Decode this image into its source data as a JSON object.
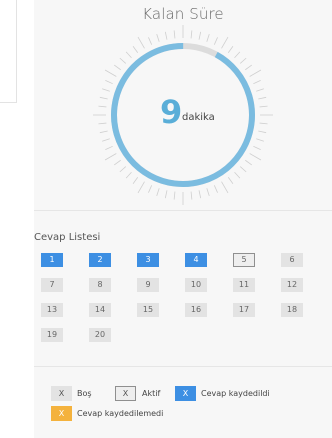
{
  "timer": {
    "title": "Kalan Süre",
    "value": "9",
    "unit": "dakika",
    "progress": 0.92,
    "color": "#7bbce0"
  },
  "answers": {
    "title": "Cevap Listesi",
    "items": [
      {
        "label": "1",
        "state": "answered"
      },
      {
        "label": "2",
        "state": "answered"
      },
      {
        "label": "3",
        "state": "answered"
      },
      {
        "label": "4",
        "state": "answered"
      },
      {
        "label": "5",
        "state": "active"
      },
      {
        "label": "6",
        "state": "empty"
      },
      {
        "label": "7",
        "state": "empty"
      },
      {
        "label": "8",
        "state": "empty"
      },
      {
        "label": "9",
        "state": "empty"
      },
      {
        "label": "10",
        "state": "empty"
      },
      {
        "label": "11",
        "state": "empty"
      },
      {
        "label": "12",
        "state": "empty"
      },
      {
        "label": "13",
        "state": "empty"
      },
      {
        "label": "14",
        "state": "empty"
      },
      {
        "label": "15",
        "state": "empty"
      },
      {
        "label": "16",
        "state": "empty"
      },
      {
        "label": "17",
        "state": "empty"
      },
      {
        "label": "18",
        "state": "empty"
      },
      {
        "label": "19",
        "state": "empty"
      },
      {
        "label": "20",
        "state": "empty"
      }
    ]
  },
  "legend": {
    "bos_box": "X",
    "bos_label": "Boş",
    "aktif_box": "X",
    "aktif_label": "Aktif",
    "saved_box": "X",
    "saved_label": "Cevap kaydedildi",
    "unsaved_box": "X",
    "unsaved_label": "Cevap kaydedilemedi"
  },
  "colors": {
    "answered": "#3d8fe3",
    "unsaved": "#f4b23d",
    "timer_ring": "#7bbce0"
  }
}
